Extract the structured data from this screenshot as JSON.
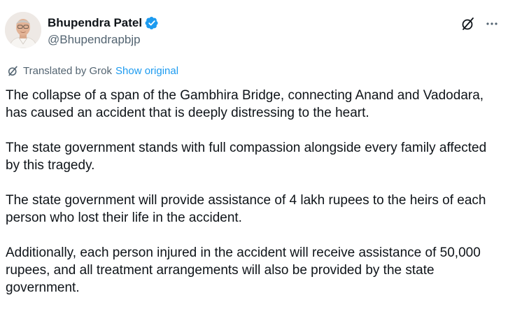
{
  "author": {
    "display_name": "Bhupendra Patel",
    "handle": "@Bhupendrapbjp",
    "verified": true,
    "avatar_icon": "avatar-portrait"
  },
  "actions": {
    "grok_icon": "grok-icon",
    "more_icon": "more-options-icon"
  },
  "translation": {
    "label": "Translated by Grok",
    "link": "Show original"
  },
  "post": {
    "paragraphs": [
      "The collapse of a span of the Gambhira Bridge, connecting Anand and Vadodara, has caused an accident that is deeply distressing to the heart.",
      "The state government stands with full compassion alongside every family affected by this tragedy.",
      "The state government will provide assistance of 4 lakh rupees to the heirs of each person who lost their life in the accident.",
      "Additionally, each person injured in the accident will receive assistance of 50,000 rupees, and all treatment arrangements will also be provided by the state government."
    ]
  },
  "colors": {
    "text": "#0f1419",
    "secondary": "#536471",
    "link": "#1d9bf0",
    "verified": "#1d9bf0"
  }
}
